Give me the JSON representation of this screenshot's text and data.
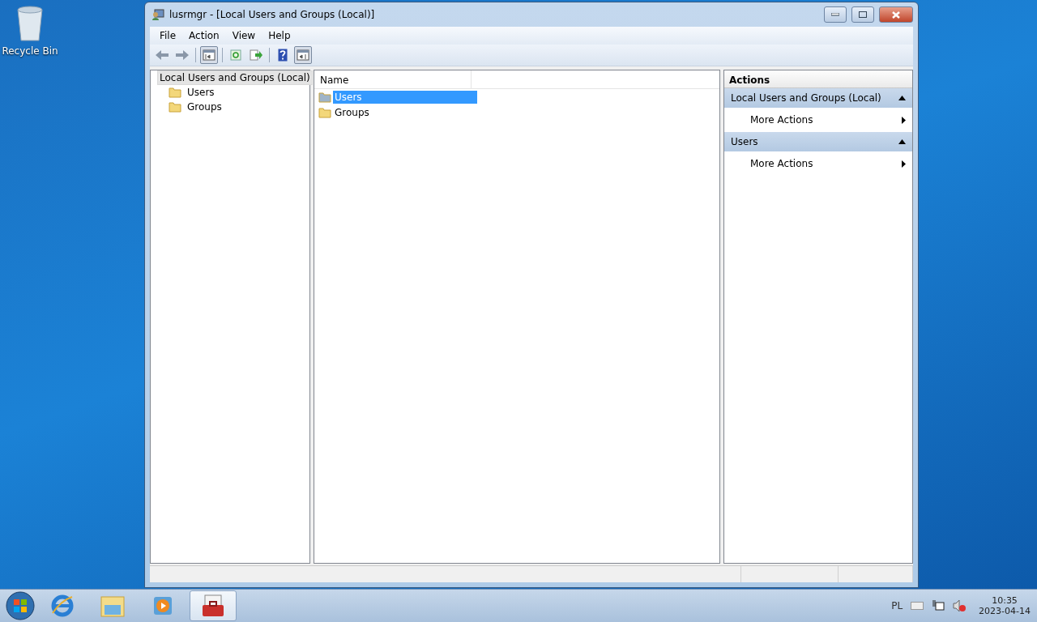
{
  "desktop": {
    "icons": [
      {
        "kind": "recycle-bin",
        "label": "Recycle Bin"
      }
    ]
  },
  "window": {
    "title": "lusrmgr - [Local Users and Groups (Local)]"
  },
  "menu": [
    "File",
    "Action",
    "View",
    "Help"
  ],
  "toolbar": [
    {
      "kind": "back",
      "pressed": false
    },
    {
      "kind": "forward",
      "pressed": false
    },
    {
      "kind": "sep"
    },
    {
      "kind": "tree-pane",
      "pressed": true
    },
    {
      "kind": "sep"
    },
    {
      "kind": "refresh",
      "pressed": false
    },
    {
      "kind": "export",
      "pressed": false
    },
    {
      "kind": "sep"
    },
    {
      "kind": "help",
      "pressed": false
    },
    {
      "kind": "action-pane",
      "pressed": true
    }
  ],
  "tree": {
    "label": "Local Users and Groups (Local)",
    "selected": true,
    "children": [
      {
        "label": "Users",
        "selected": false
      },
      {
        "label": "Groups",
        "selected": false
      }
    ]
  },
  "list": {
    "columns": [
      "Name"
    ],
    "items": [
      {
        "label": "Users",
        "selected": true
      },
      {
        "label": "Groups",
        "selected": false
      }
    ]
  },
  "actions": {
    "title": "Actions",
    "sections": [
      {
        "title": "Local Users and Groups (Local)",
        "expanded": true,
        "items": [
          "More Actions"
        ]
      },
      {
        "title": "Users",
        "expanded": true,
        "items": [
          "More Actions"
        ]
      }
    ]
  },
  "taskbar": {
    "items": [
      {
        "kind": "browser",
        "active": false
      },
      {
        "kind": "folder",
        "active": false
      },
      {
        "kind": "media",
        "active": false
      },
      {
        "kind": "toolbox",
        "active": true
      }
    ],
    "tray": {
      "language": "PL",
      "time": "10:35",
      "date": "2023-04-14"
    }
  }
}
